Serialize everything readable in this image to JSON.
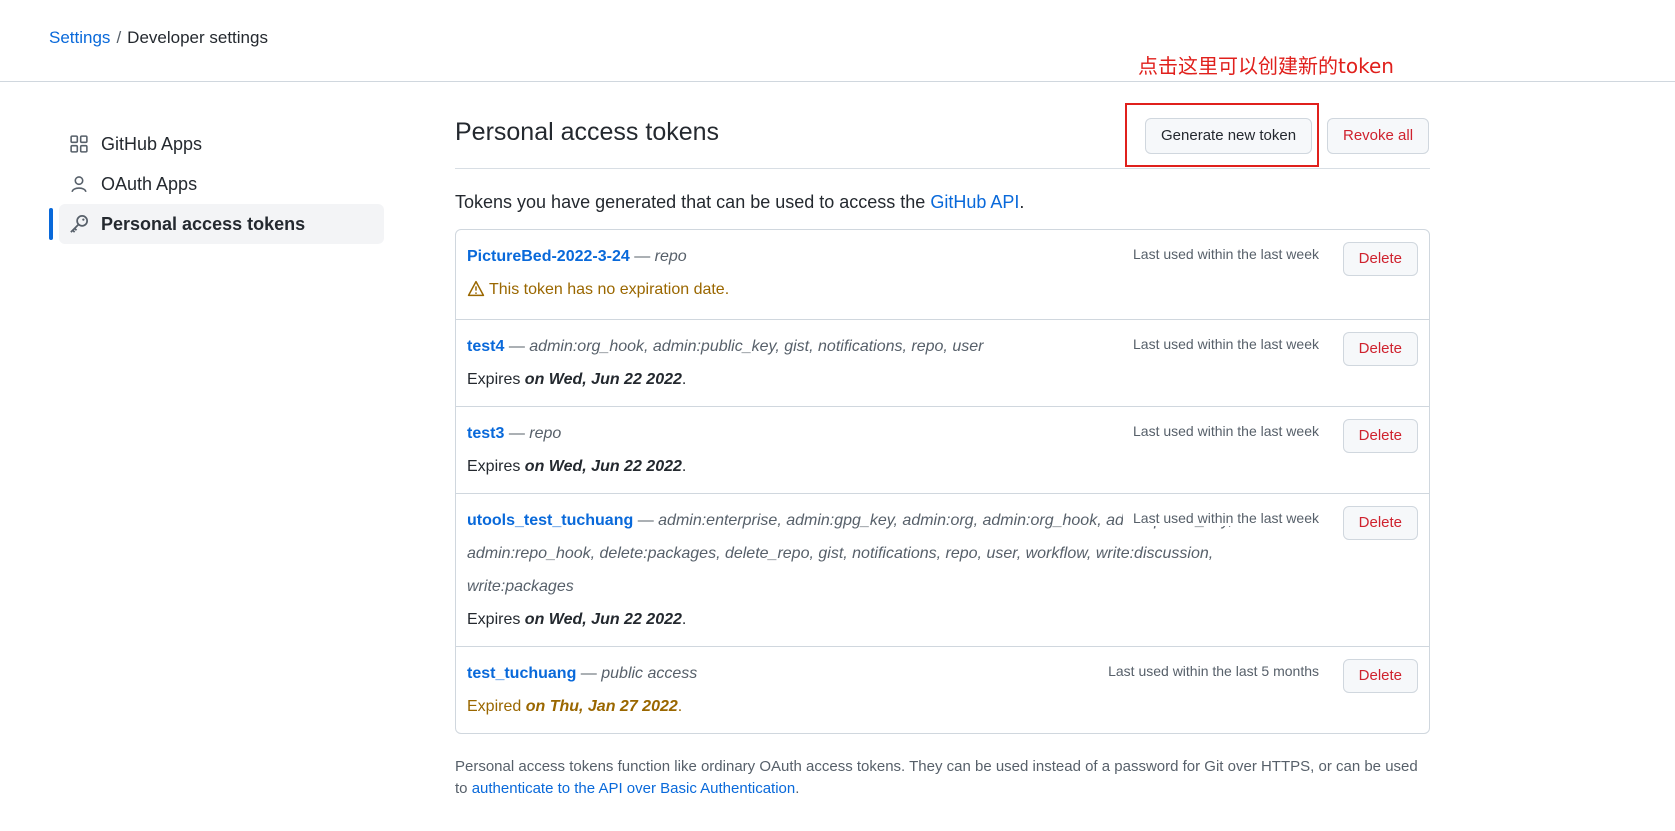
{
  "breadcrumb": {
    "root": "Settings",
    "separator": "/",
    "current": "Developer settings"
  },
  "annotation": {
    "text": "点击这里可以创建新的token",
    "color": "#e0201c"
  },
  "sidebar": {
    "items": [
      {
        "label": "GitHub Apps",
        "icon": "apps-grid-icon",
        "active": false
      },
      {
        "label": "OAuth Apps",
        "icon": "person-icon",
        "active": false
      },
      {
        "label": "Personal access tokens",
        "icon": "key-icon",
        "active": true
      }
    ]
  },
  "main": {
    "title": "Personal access tokens",
    "generate_label": "Generate new token",
    "revoke_label": "Revoke all",
    "intro_text": "Tokens you have generated that can be used to access the ",
    "intro_link": "GitHub API",
    "intro_end": ".",
    "tokens": [
      {
        "name": "PictureBed-2022-3-24",
        "scopes": "repo",
        "last_used": "Last used within the last week",
        "status_type": "warning",
        "status_text": "This token has no expiration date.",
        "status_prefix": "",
        "status_date": "",
        "status_suffix": "",
        "delete_label": "Delete"
      },
      {
        "name": "test4",
        "scopes": "admin:org_hook, admin:public_key, gist, notifications, repo, user",
        "last_used": "Last used within the last week",
        "status_type": "expires",
        "status_prefix": "Expires ",
        "status_date": "on Wed, Jun 22 2022",
        "status_suffix": ".",
        "delete_label": "Delete"
      },
      {
        "name": "test3",
        "scopes": "repo",
        "last_used": "Last used within the last week",
        "status_type": "expires",
        "status_prefix": "Expires ",
        "status_date": "on Wed, Jun 22 2022",
        "status_suffix": ".",
        "delete_label": "Delete"
      },
      {
        "name": "utools_test_tuchuang",
        "scopes": "admin:enterprise, admin:gpg_key, admin:org, admin:org_hook, admin:public_key, admin:repo_hook, delete:packages, delete_repo, gist, notifications, repo, user, workflow, write:discussion, write:packages",
        "last_used": "Last used within the last week",
        "status_type": "expires",
        "status_prefix": "Expires ",
        "status_date": "on Wed, Jun 22 2022",
        "status_suffix": ".",
        "delete_label": "Delete"
      },
      {
        "name": "test_tuchuang",
        "scopes": "public access",
        "last_used": "Last used within the last 5 months",
        "status_type": "expired",
        "status_prefix": "Expired ",
        "status_date": "on Thu, Jan 27 2022",
        "status_suffix": ".",
        "delete_label": "Delete"
      }
    ],
    "footnote_text": "Personal access tokens function like ordinary OAuth access tokens. They can be used instead of a password for Git over HTTPS, or can be used to ",
    "footnote_link": "authenticate to the API over Basic Authentication",
    "footnote_end": "."
  },
  "colors": {
    "link": "#0969da",
    "danger": "#cf222e",
    "warning": "#9a6700",
    "accent": "#0969da"
  }
}
